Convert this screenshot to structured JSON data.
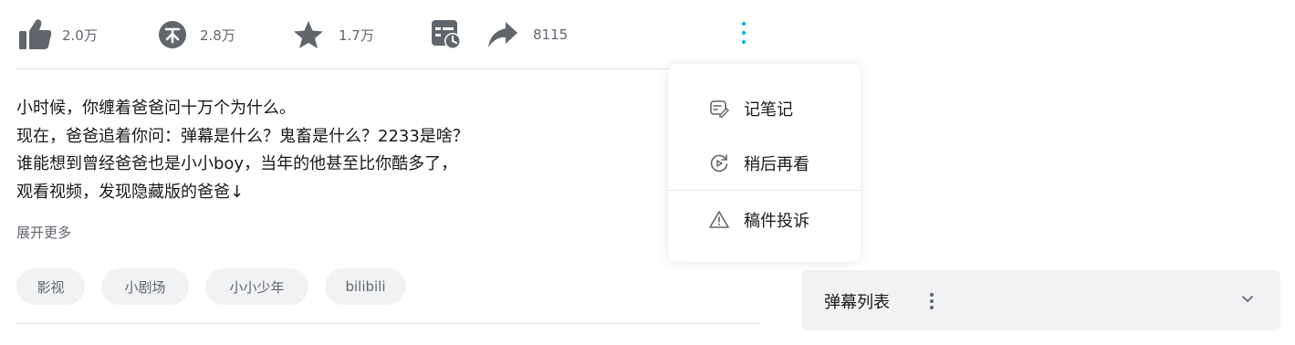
{
  "toolbar": {
    "like": {
      "icon": "thumb-up-icon",
      "count": "2.0万"
    },
    "coin": {
      "icon": "coin-icon",
      "count": "2.8万"
    },
    "favorite": {
      "icon": "star-icon",
      "count": "1.7万"
    },
    "watch_later": {
      "icon": "calendar-clock-icon"
    },
    "share": {
      "icon": "share-arrow-icon",
      "count": "8115"
    },
    "more": {
      "icon": "more-vertical-icon"
    }
  },
  "description": {
    "lines": [
      "小时候，你缠着爸爸问十万个为什么。",
      "现在，爸爸追着你问：弹幕是什么？鬼畜是什么？2233是啥？",
      "谁能想到曾经爸爸也是小小boy，当年的他甚至比你酷多了，",
      "观看视频，发现隐藏版的爸爸↓"
    ],
    "expand_label": "展开更多"
  },
  "tags": [
    "影视",
    "小剧场",
    "小小少年",
    "bilibili"
  ],
  "more_menu": {
    "items": [
      {
        "label": "记笔记",
        "icon": "note-icon"
      },
      {
        "label": "稍后再看",
        "icon": "watch-later-icon"
      },
      {
        "label": "稿件投诉",
        "icon": "warning-icon"
      }
    ]
  },
  "danmaku_panel": {
    "title": "弹幕列表",
    "icon": "chevron-down-icon"
  },
  "colors": {
    "accent": "#00aeec",
    "icon_dark": "#61666d",
    "tag_bg": "#f1f2f3",
    "text": "#18191c"
  }
}
